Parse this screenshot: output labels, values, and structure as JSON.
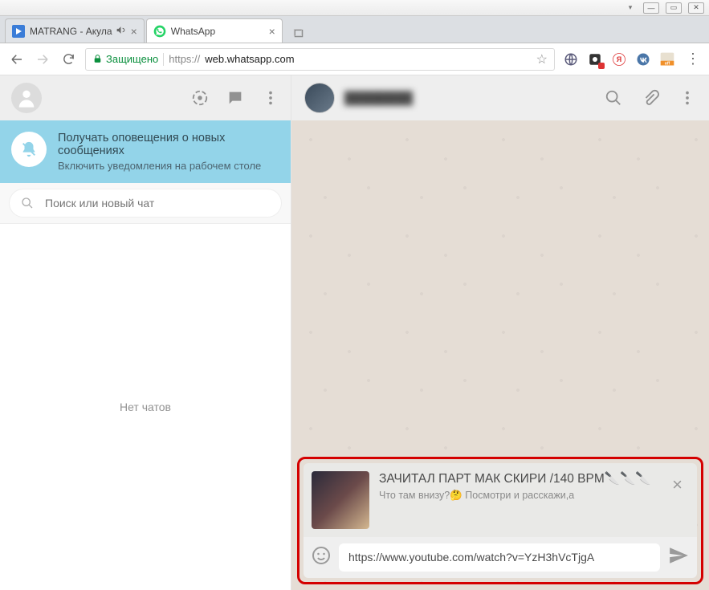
{
  "window": {
    "tab1_title": "MATRANG - Акула",
    "tab2_title": "WhatsApp"
  },
  "omnibar": {
    "secure_label": "Защищено",
    "url_scheme": "https://",
    "url_host": "web.whatsapp.com"
  },
  "sidebar": {
    "notif_title": "Получать оповещения о новых сообщениях",
    "notif_sub": "Включить уведомления на рабочем столе",
    "search_placeholder": "Поиск или новый чат",
    "empty_label": "Нет чатов"
  },
  "conv": {
    "contact_name": "████████",
    "preview_title": "ЗАЧИТАЛ ПАРТ МАК СКИРИ /140 BPM🔪🔪🔪",
    "preview_sub": "Что там внизу?🤔 Посмотри и расскажи,а",
    "input_value": "https://www.youtube.com/watch?v=YzH3hVcTjgA"
  }
}
